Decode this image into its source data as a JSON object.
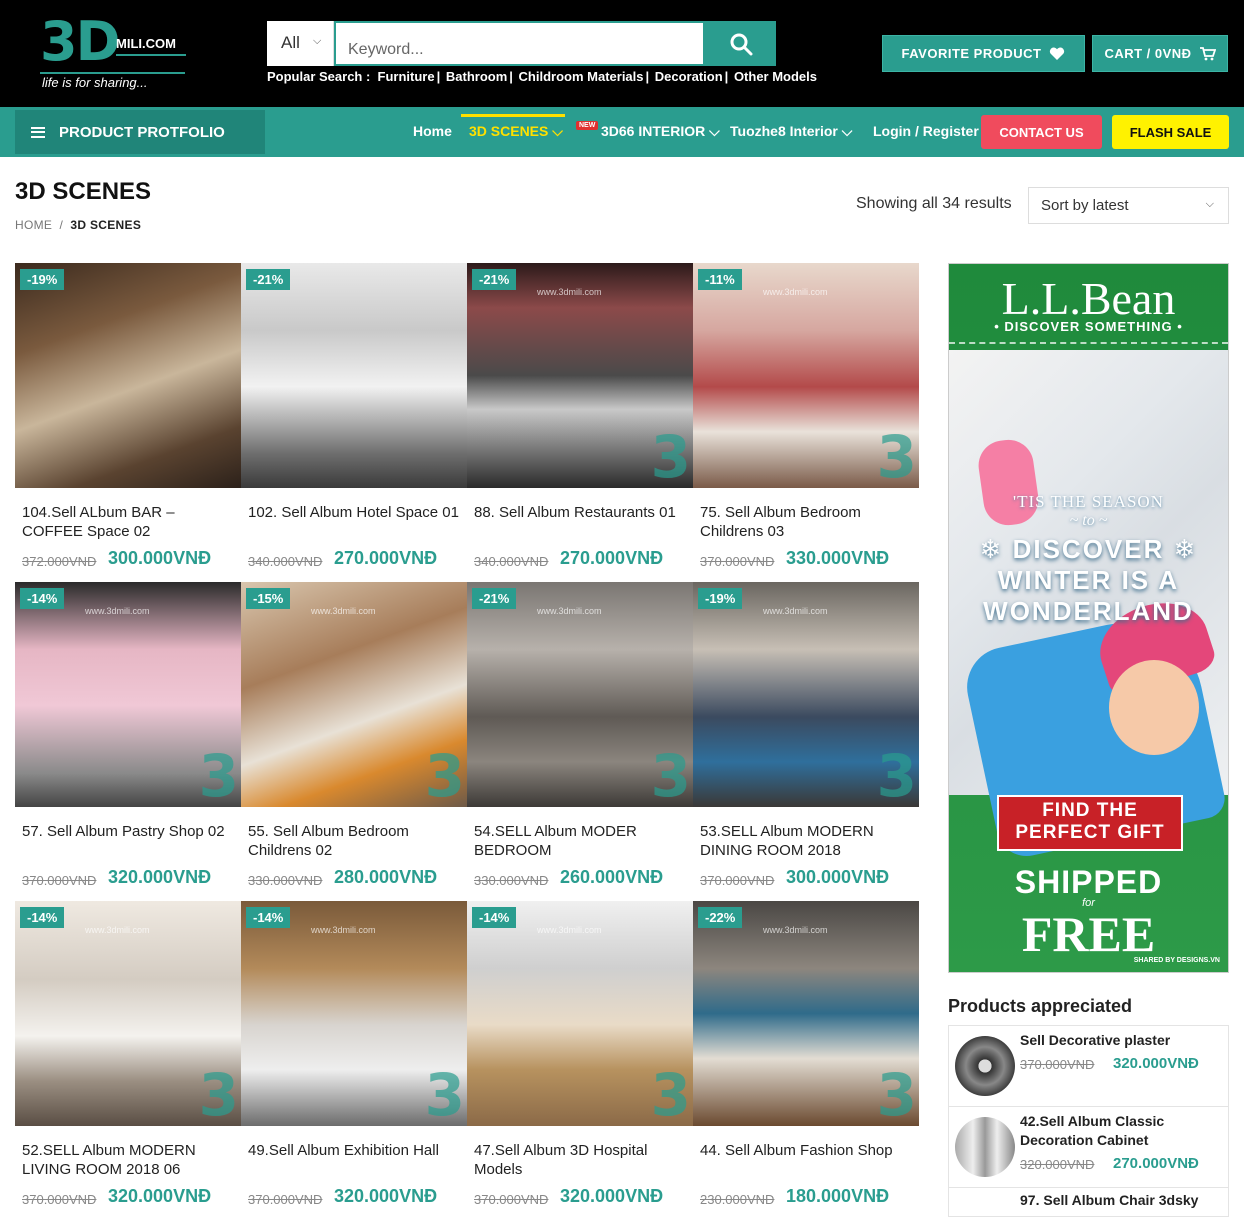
{
  "header": {
    "logo_big": "3D",
    "logo_small": "MILI.COM",
    "tagline": "life is for sharing...",
    "search_category": "All",
    "search_placeholder": "Keyword...",
    "popular_label": "Popular Search :",
    "popular_links": [
      "Furniture",
      "Bathroom",
      "Childroom Materials",
      "Decoration",
      "Other Models"
    ],
    "favorite_label": "FAVORITE PRODUCT",
    "cart_label": "CART / 0VNĐ"
  },
  "nav": {
    "portfolio_label": "PRODUCT PROTFOLIO",
    "items": [
      {
        "label": "Home"
      },
      {
        "label": "3D SCENES",
        "active": true,
        "dropdown": true
      },
      {
        "label": "3D66 INTERIOR",
        "dropdown": true,
        "badge": "NEW"
      },
      {
        "label": "Tuozhe8 Interior",
        "dropdown": true
      },
      {
        "label": "Login / Register"
      }
    ],
    "contact_label": "CONTACT US",
    "flash_label": "FLASH SALE"
  },
  "page": {
    "title": "3D SCENES",
    "breadcrumb_home": "HOME",
    "breadcrumb_sep": "/",
    "breadcrumb_current": "3D SCENES",
    "results": "Showing all 34 results",
    "sort_value": "Sort by latest"
  },
  "products": [
    {
      "badge": "-19%",
      "title": "104.Sell ALbum BAR – COFFEE Space 02",
      "old_price": "372.000VNĐ",
      "price": "300.000VNĐ"
    },
    {
      "badge": "-21%",
      "title": "102. Sell Album Hotel Space 01",
      "old_price": "340.000VNĐ",
      "price": "270.000VNĐ"
    },
    {
      "badge": "-21%",
      "title": "88. Sell Album Restaurants 01",
      "old_price": "340.000VNĐ",
      "price": "270.000VNĐ"
    },
    {
      "badge": "-11%",
      "title": "75. Sell Album Bedroom Childrens 03",
      "old_price": "370.000VNĐ",
      "price": "330.000VNĐ"
    },
    {
      "badge": "-14%",
      "title": "57. Sell Album Pastry Shop 02",
      "old_price": "370.000VNĐ",
      "price": "320.000VNĐ"
    },
    {
      "badge": "-15%",
      "title": "55. Sell Album Bedroom Childrens 02",
      "old_price": "330.000VNĐ",
      "price": "280.000VNĐ"
    },
    {
      "badge": "-21%",
      "title": "54.SELL Album MODER BEDROOM",
      "old_price": "330.000VNĐ",
      "price": "260.000VNĐ"
    },
    {
      "badge": "-19%",
      "title": "53.SELL Album MODERN DINING ROOM 2018",
      "old_price": "370.000VNĐ",
      "price": "300.000VNĐ"
    },
    {
      "badge": "-14%",
      "title": "52.SELL Album MODERN LIVING ROOM 2018 06",
      "old_price": "370.000VNĐ",
      "price": "320.000VNĐ"
    },
    {
      "badge": "-14%",
      "title": "49.Sell Album Exhibition Hall",
      "old_price": "370.000VNĐ",
      "price": "320.000VNĐ"
    },
    {
      "badge": "-14%",
      "title": "47.Sell Album 3D Hospital Models",
      "old_price": "370.000VNĐ",
      "price": "320.000VNĐ"
    },
    {
      "badge": "-22%",
      "title": "44. Sell Album Fashion Shop",
      "old_price": "230.000VNĐ",
      "price": "180.000VNĐ"
    }
  ],
  "watermark_url": "www.3dmili.com",
  "watermark_mark": "3",
  "ad": {
    "brand": "L.L.Bean",
    "discover": "• DISCOVER SOMETHING •",
    "season": "'TIS THE SEASON",
    "to": "~ to ~",
    "headline_1": "❄ DISCOVER ❄",
    "headline_2": "WINTER IS A",
    "headline_3": "WONDERLAND",
    "gift_1": "FIND THE",
    "gift_2": "PERFECT GIFT",
    "shipped": "SHIPPED",
    "for": "for",
    "free": "FREE",
    "shared": "SHARED BY DESIGNS.VN"
  },
  "appreciated": {
    "title": "Products appreciated",
    "items": [
      {
        "name": "Sell Decorative plaster",
        "old_price": "370.000VNĐ",
        "price": "320.000VNĐ"
      },
      {
        "name": "42.Sell Album Classic Decoration Cabinet",
        "old_price": "320.000VNĐ",
        "price": "270.000VNĐ"
      },
      {
        "name": "97. Sell Album Chair 3dsky"
      }
    ]
  }
}
